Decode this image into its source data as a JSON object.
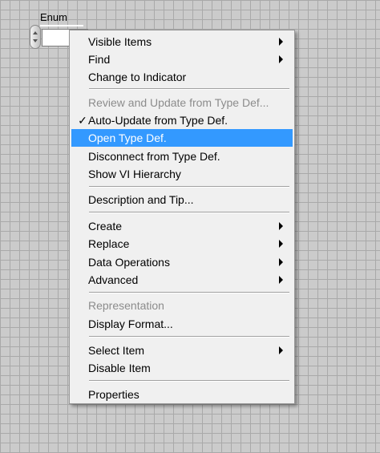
{
  "enum_control": {
    "label": "Enum"
  },
  "context_menu": {
    "items": [
      {
        "label": "Visible Items",
        "submenu": true
      },
      {
        "label": "Find",
        "submenu": true
      },
      {
        "label": "Change to Indicator"
      },
      {
        "label": "Review and Update from Type Def...",
        "disabled": true
      },
      {
        "label": "Auto-Update from Type Def.",
        "checked": true,
        "check_mark": "✓"
      },
      {
        "label": "Open Type Def.",
        "highlighted": true
      },
      {
        "label": "Disconnect from Type Def."
      },
      {
        "label": "Show VI Hierarchy"
      },
      {
        "label": "Description and Tip..."
      },
      {
        "label": "Create",
        "submenu": true
      },
      {
        "label": "Replace",
        "submenu": true
      },
      {
        "label": "Data Operations",
        "submenu": true
      },
      {
        "label": "Advanced",
        "submenu": true
      },
      {
        "label": "Representation",
        "disabled": true
      },
      {
        "label": "Display Format..."
      },
      {
        "label": "Select Item",
        "submenu": true
      },
      {
        "label": "Disable Item"
      },
      {
        "label": "Properties"
      }
    ]
  },
  "colors": {
    "highlight": "#3399ff",
    "disabled_text": "#8c8c8c",
    "menu_background": "#f0f0f0",
    "grid_background": "#cbcbcb"
  }
}
